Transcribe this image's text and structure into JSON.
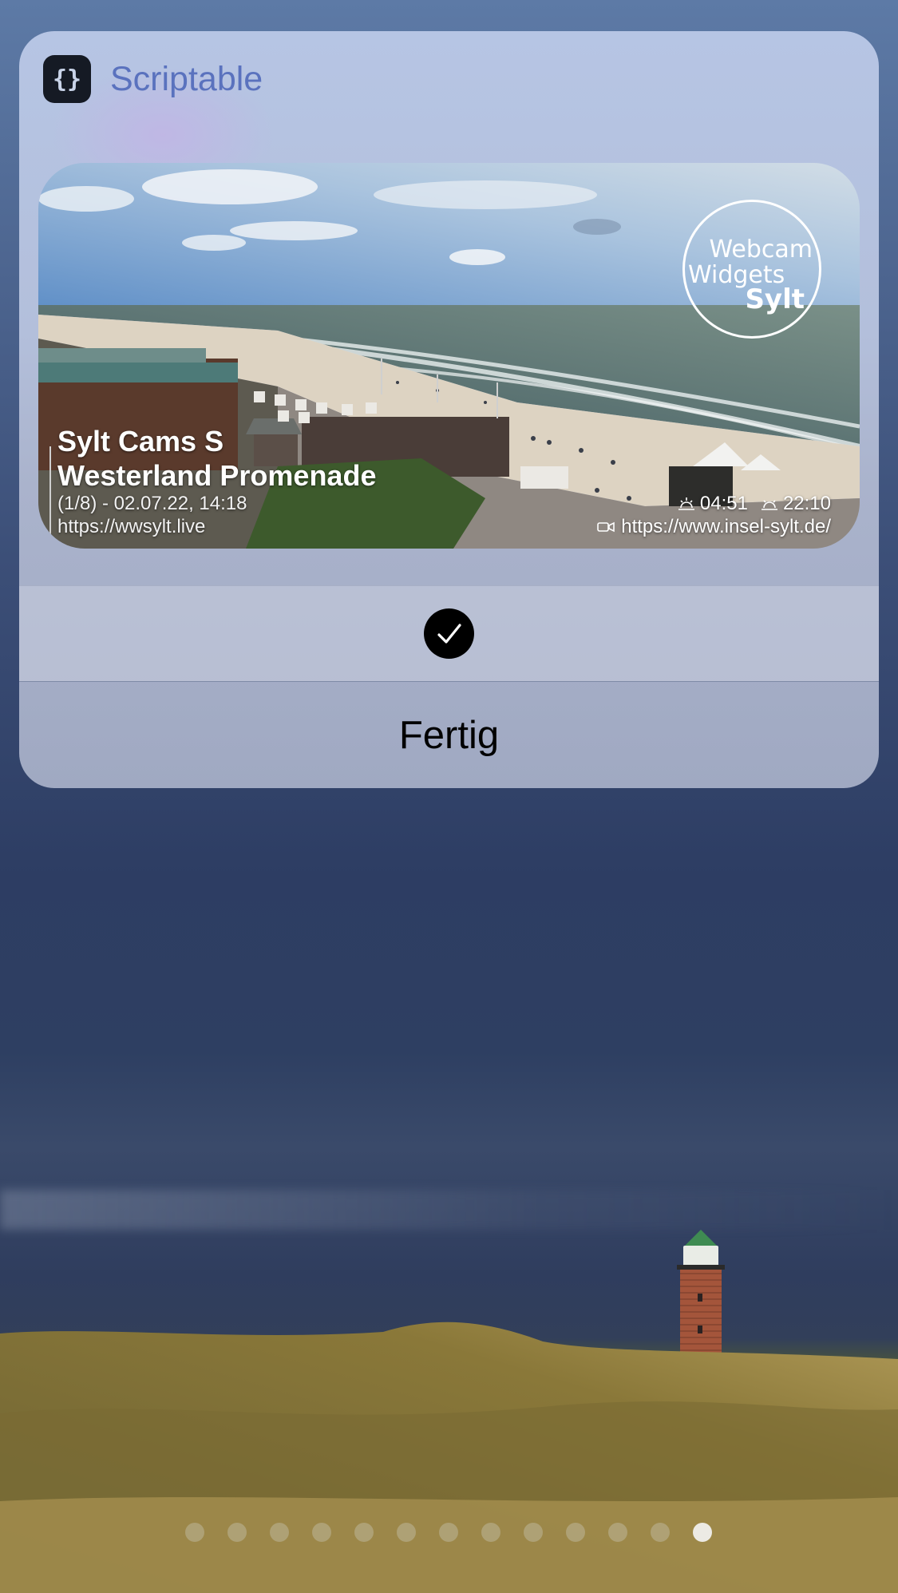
{
  "widget_picker": {
    "app_name": "Scriptable",
    "app_icon_glyph": "{}",
    "widget": {
      "title_line1": "Sylt Cams S",
      "title_line2": "Westerland Promenade",
      "subtitle": "(1/8) - 02.07.22, 14:18",
      "source_url": "https://wwsylt.live",
      "sunrise": "04:51",
      "sunset": "22:10",
      "cam_url": "https://www.insel-sylt.de/",
      "logo": [
        "Webcam",
        "Widgets",
        "Sylt"
      ]
    },
    "selected": true,
    "done_label": "Fertig"
  },
  "page_indicator": {
    "count": 13,
    "active_index": 12
  },
  "colors": {
    "app_name": "#5a72be",
    "check_bg": "#000000"
  },
  "icons": [
    "scriptable-app-icon",
    "sunrise-icon",
    "sunset-icon",
    "video-camera-icon",
    "checkmark-icon"
  ]
}
